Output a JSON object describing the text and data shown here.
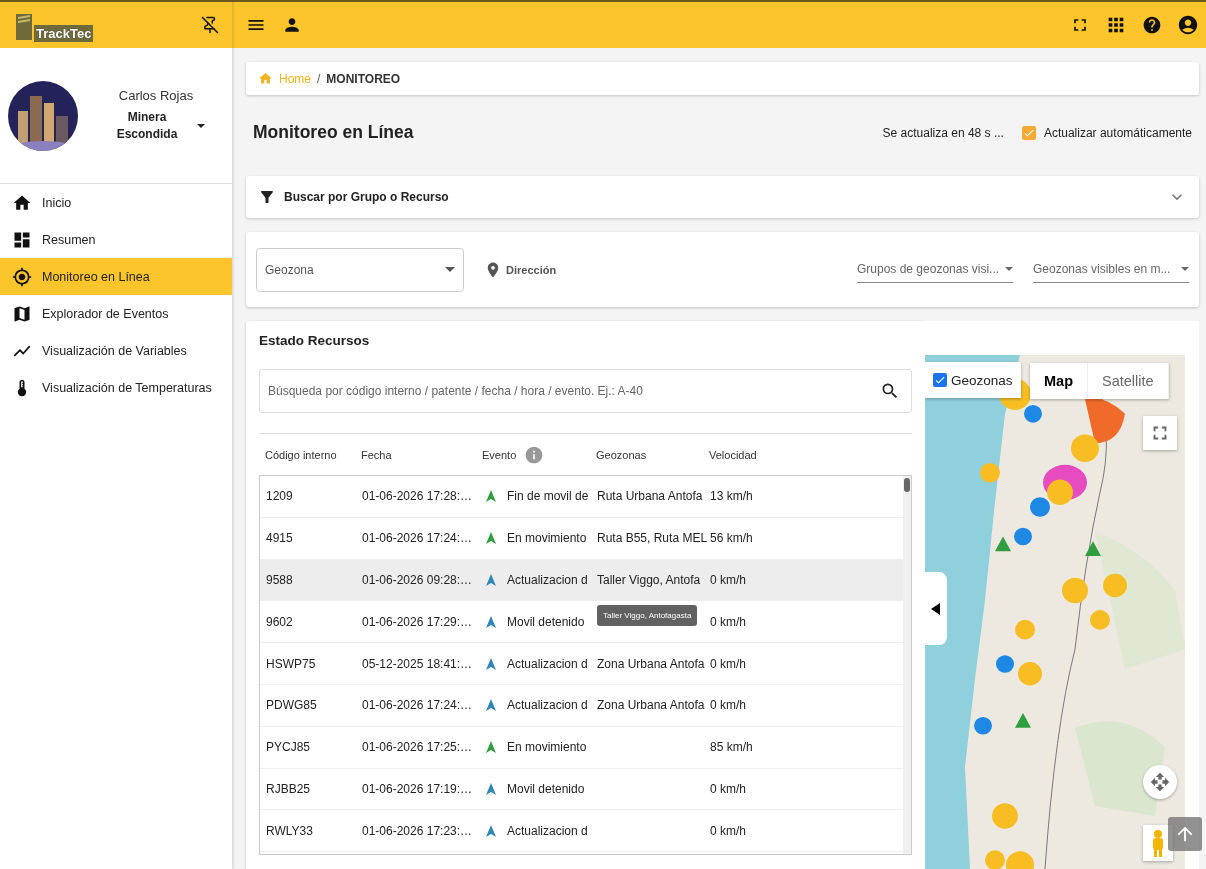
{
  "header": {
    "logo": "TrackTec"
  },
  "profile": {
    "name": "Carlos Rojas",
    "company": "Minera Escondida"
  },
  "nav": [
    {
      "label": "Inicio",
      "selected": false
    },
    {
      "label": "Resumen",
      "selected": false
    },
    {
      "label": "Monitoreo en Línea",
      "selected": true
    },
    {
      "label": "Explorador de Eventos",
      "selected": false
    },
    {
      "label": "Visualización de Variables",
      "selected": false
    },
    {
      "label": "Visualización de Temperaturas",
      "selected": false
    }
  ],
  "breadcrumb": {
    "separator": "/",
    "items": [
      {
        "label": "Home",
        "kind": "link"
      },
      {
        "label": "MONITOREO",
        "kind": "current"
      }
    ]
  },
  "title": "Monitoreo en Línea",
  "refresh": {
    "countdown": "Se actualiza en 48 s ...",
    "auto_label": "Actualizar automáticamente",
    "checked": true
  },
  "filter": {
    "title": "Buscar por Grupo o Recurso",
    "expanded": false
  },
  "geo_filters": {
    "geozona": "Geozona",
    "address": "Dirección",
    "groups": "Grupos de geozonas visi...",
    "visible": "Geozonas visibles en m..."
  },
  "resources": {
    "title": "Estado Recursos",
    "search_placeholder": "Búsqueda por código interno / patente / fecha / hora / evento. Ej.: A-40",
    "columns": [
      "Código interno",
      "Fecha",
      "Evento",
      "Geozonas",
      "Velocidad"
    ],
    "rows": [
      {
        "code": "1209",
        "date": "01-06-2026 17:28:…",
        "event": "Fin de movil de",
        "geozone": "Ruta Urbana Antofa",
        "speed": "13 km/h",
        "color": "#2e9e3e",
        "selected": false
      },
      {
        "code": "4915",
        "date": "01-06-2026 17:24:…",
        "event": "En movimiento",
        "geozone": "Ruta B55, Ruta MEL",
        "speed": "56 km/h",
        "color": "#2e9e3e",
        "selected": false
      },
      {
        "code": "9588",
        "date": "01-06-2026 09:28:…",
        "event": "Actualizacion d",
        "geozone": "Taller Viggo, Antofa",
        "speed": "0 km/h",
        "color": "#2f86b8",
        "selected": true
      },
      {
        "code": "9602",
        "date": "01-06-2026 17:29:…",
        "event": "Movil detenido",
        "speed": "0 km/h",
        "color": "#2f86b8",
        "selected": false,
        "tooltip": "Taller Viggo, Antofagasta"
      },
      {
        "code": "HSWP75",
        "date": "05-12-2025 18:41:…",
        "event": "Actualizacion d",
        "geozone": "Zona Urbana Antofa",
        "speed": "0 km/h",
        "color": "#2f86b8",
        "selected": false
      },
      {
        "code": "PDWG85",
        "date": "01-06-2026 17:24:…",
        "event": "Actualizacion d",
        "geozone": "Zona Urbana Antofa",
        "speed": "0 km/h",
        "color": "#2f86b8",
        "selected": false
      },
      {
        "code": "PYCJ85",
        "date": "01-06-2026 17:25:…",
        "event": "En movimiento",
        "speed": "85 km/h",
        "color": "#2e9e3e",
        "selected": false
      },
      {
        "code": "RJBB25",
        "date": "01-06-2026 17:19:…",
        "event": "Movil detenido",
        "speed": "0 km/h",
        "color": "#2f86b8",
        "selected": false
      },
      {
        "code": "RWLY33",
        "date": "01-06-2026 17:23:…",
        "event": "Actualizacion d",
        "speed": "0 km/h",
        "color": "#2f86b8",
        "selected": false
      }
    ]
  },
  "map": {
    "geozones_label": "Geozonas",
    "geozones_checked": true,
    "types": [
      {
        "label": "Map",
        "selected": true
      },
      {
        "label": "Satellite",
        "selected": false
      }
    ]
  }
}
